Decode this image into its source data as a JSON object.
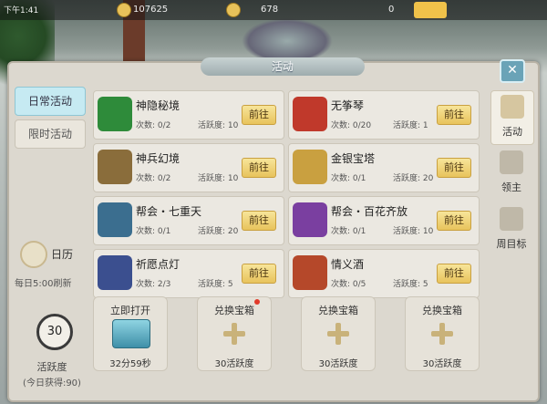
{
  "topbar": {
    "time": "下午1:41",
    "silver": "107625",
    "gold": "678",
    "yuanbao": "0"
  },
  "panel": {
    "title": "活动",
    "close_icon": "close-icon",
    "tabs": [
      "日常活动",
      "限时活动"
    ],
    "calendar_label": "日历",
    "refresh_text": "每日5:00刷新",
    "huoyue_value": "30",
    "huoyue_label": "活跃度",
    "huoyue_today": "(今日获得:90)"
  },
  "activities": [
    {
      "name": "神隐秘境",
      "count": "次数: 0/2",
      "activity": "活跃度: 10",
      "go": "前往",
      "icon": "green-flame-icon",
      "color": "#2e8b3a"
    },
    {
      "name": "无筝琴",
      "count": "次数: 0/20",
      "activity": "活跃度: 1",
      "go": "前往",
      "icon": "instrument-icon",
      "color": "#c0392b"
    },
    {
      "name": "神兵幻境",
      "count": "次数: 0/2",
      "activity": "活跃度: 10",
      "go": "前往",
      "icon": "sword-icon",
      "color": "#8a6d3b"
    },
    {
      "name": "金银宝塔",
      "count": "次数: 0/1",
      "activity": "活跃度: 20",
      "go": "前往",
      "icon": "pagoda-icon",
      "color": "#c9a040"
    },
    {
      "name": "帮会・七重天",
      "count": "次数: 0/1",
      "activity": "活跃度: 20",
      "go": "前往",
      "icon": "guild-shield-icon",
      "color": "#3b6e8f"
    },
    {
      "name": "帮会・百花齐放",
      "count": "次数: 0/1",
      "activity": "活跃度: 10",
      "go": "前往",
      "icon": "flower-icon",
      "color": "#7a3fa0"
    },
    {
      "name": "祈愿点灯",
      "count": "次数: 2/3",
      "activity": "活跃度: 5",
      "go": "前往",
      "icon": "lantern-chest-icon",
      "color": "#3b4f8f"
    },
    {
      "name": "情义酒",
      "count": "次数: 0/5",
      "activity": "活跃度: 5",
      "go": "前往",
      "icon": "wine-jar-icon",
      "color": "#b5482a"
    }
  ],
  "rewards": [
    {
      "top": "立即打开",
      "bottom": "32分59秒",
      "type": "chest"
    },
    {
      "top": "兑换宝箱",
      "bottom": "30活跃度",
      "type": "plus",
      "dot": true
    },
    {
      "top": "兑换宝箱",
      "bottom": "30活跃度",
      "type": "plus"
    },
    {
      "top": "兑换宝箱",
      "bottom": "30活跃度",
      "type": "plus"
    }
  ],
  "side_tabs": [
    "活动",
    "领主",
    "周目标"
  ]
}
